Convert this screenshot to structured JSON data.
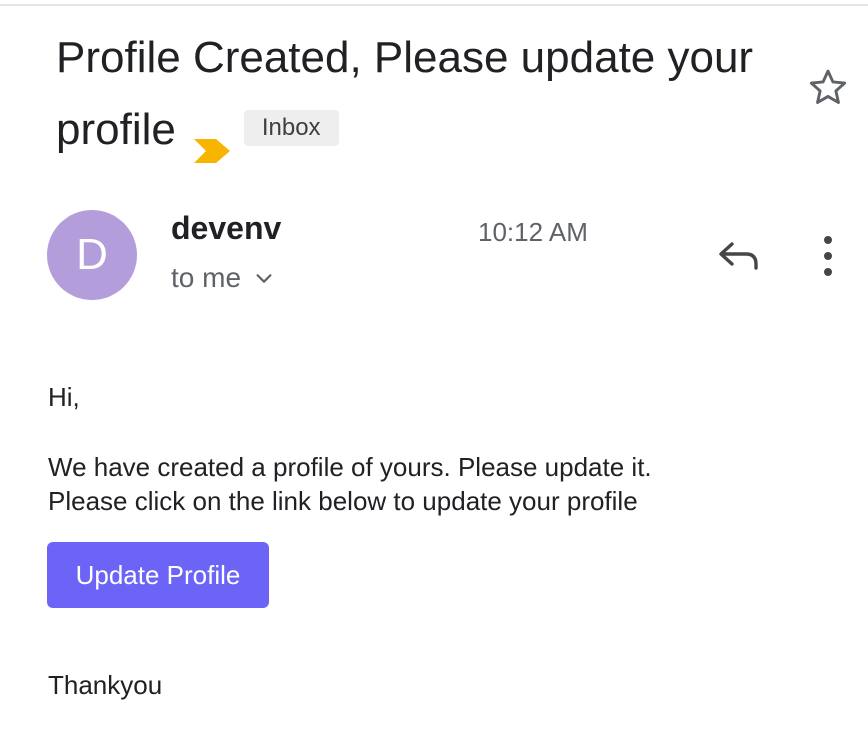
{
  "email": {
    "subject": "Profile Created, Please update your profile",
    "label": "Inbox",
    "sender": {
      "initial": "D",
      "name": "devenv"
    },
    "time": "10:12 AM",
    "recipient": "to me",
    "body": {
      "greeting": "Hi,",
      "line1": "We have created a profile of yours. Please update it.",
      "line2": "Please click on the link below to update your profile",
      "cta_label": "Update Profile",
      "signoff": "Thankyou"
    }
  },
  "icons": {
    "importance": "importance-marker-icon",
    "star": "star-icon",
    "chevron": "chevron-down-icon",
    "reply": "reply-icon",
    "more": "more-vert-icon"
  },
  "colors": {
    "avatar": "#b39ddb",
    "cta": "#6c63f7",
    "importance": "#f7b500",
    "chip_bg": "#eeeeee"
  }
}
